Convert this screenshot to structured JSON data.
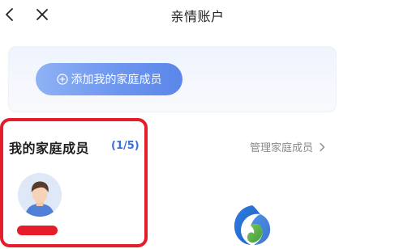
{
  "header": {
    "title": "亲情账户",
    "back_icon": "chevron-left-icon",
    "close_icon": "close-icon"
  },
  "add_card": {
    "button_label": "添加我的家庭成员",
    "button_icon": "plus-circle-icon"
  },
  "members": {
    "title": "我的家庭成员",
    "count": "(1/5)",
    "manage_label": "管理家庭成员",
    "manage_icon": "chevron-right-icon",
    "avatar_icon": "user-avatar-icon"
  },
  "colors": {
    "accent_blue": "#5b86ea",
    "count_blue": "#3a6fd8",
    "highlight_red": "#e51c2a",
    "title_text": "#1e1e1e",
    "muted_text": "#8a8a8a"
  }
}
